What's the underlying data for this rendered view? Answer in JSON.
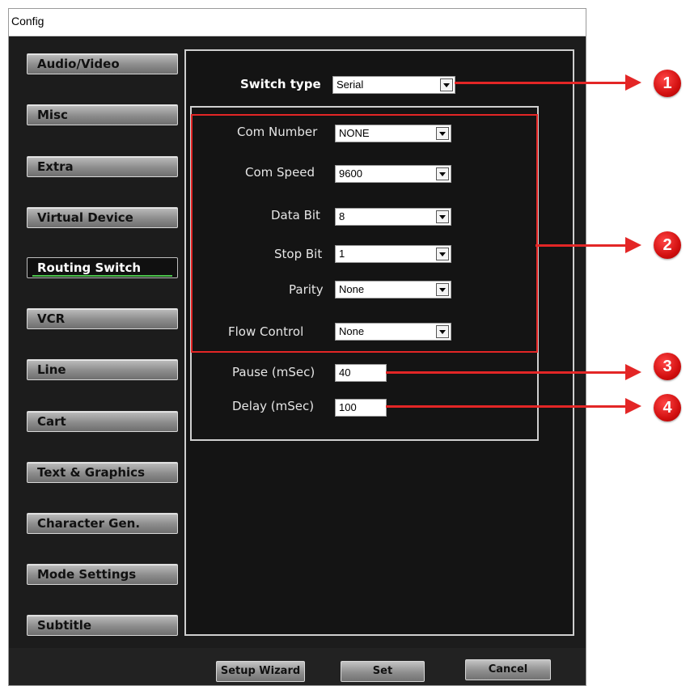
{
  "window": {
    "title": "Config"
  },
  "sidebar": {
    "items": [
      {
        "label": "Audio/Video"
      },
      {
        "label": "Misc"
      },
      {
        "label": "Extra"
      },
      {
        "label": "Virtual Device"
      },
      {
        "label": "Routing Switch",
        "active": true
      },
      {
        "label": "VCR"
      },
      {
        "label": "Line"
      },
      {
        "label": "Cart"
      },
      {
        "label": "Text & Graphics"
      },
      {
        "label": "Character Gen."
      },
      {
        "label": "Mode Settings"
      },
      {
        "label": "Subtitle"
      }
    ]
  },
  "form": {
    "switch_type": {
      "label": "Switch type",
      "value": "Serial"
    },
    "com_number": {
      "label": "Com Number",
      "value": "NONE"
    },
    "com_speed": {
      "label": "Com Speed",
      "value": "9600"
    },
    "data_bit": {
      "label": "Data Bit",
      "value": "8"
    },
    "stop_bit": {
      "label": "Stop Bit",
      "value": "1"
    },
    "parity": {
      "label": "Parity",
      "value": "None"
    },
    "flow_control": {
      "label": "Flow Control",
      "value": "None"
    },
    "pause": {
      "label": "Pause (mSec)",
      "value": "40"
    },
    "delay": {
      "label": "Delay (mSec)",
      "value": "100"
    }
  },
  "footer": {
    "setup_wizard_label": "Setup Wizard",
    "set_label": "Set",
    "cancel_label": "Cancel"
  },
  "callouts": [
    "1",
    "2",
    "3",
    "4"
  ],
  "colors": {
    "annotation_red": "#e32626",
    "active_underline": "#4bc24b",
    "window_bg": "#1c1c1c"
  }
}
